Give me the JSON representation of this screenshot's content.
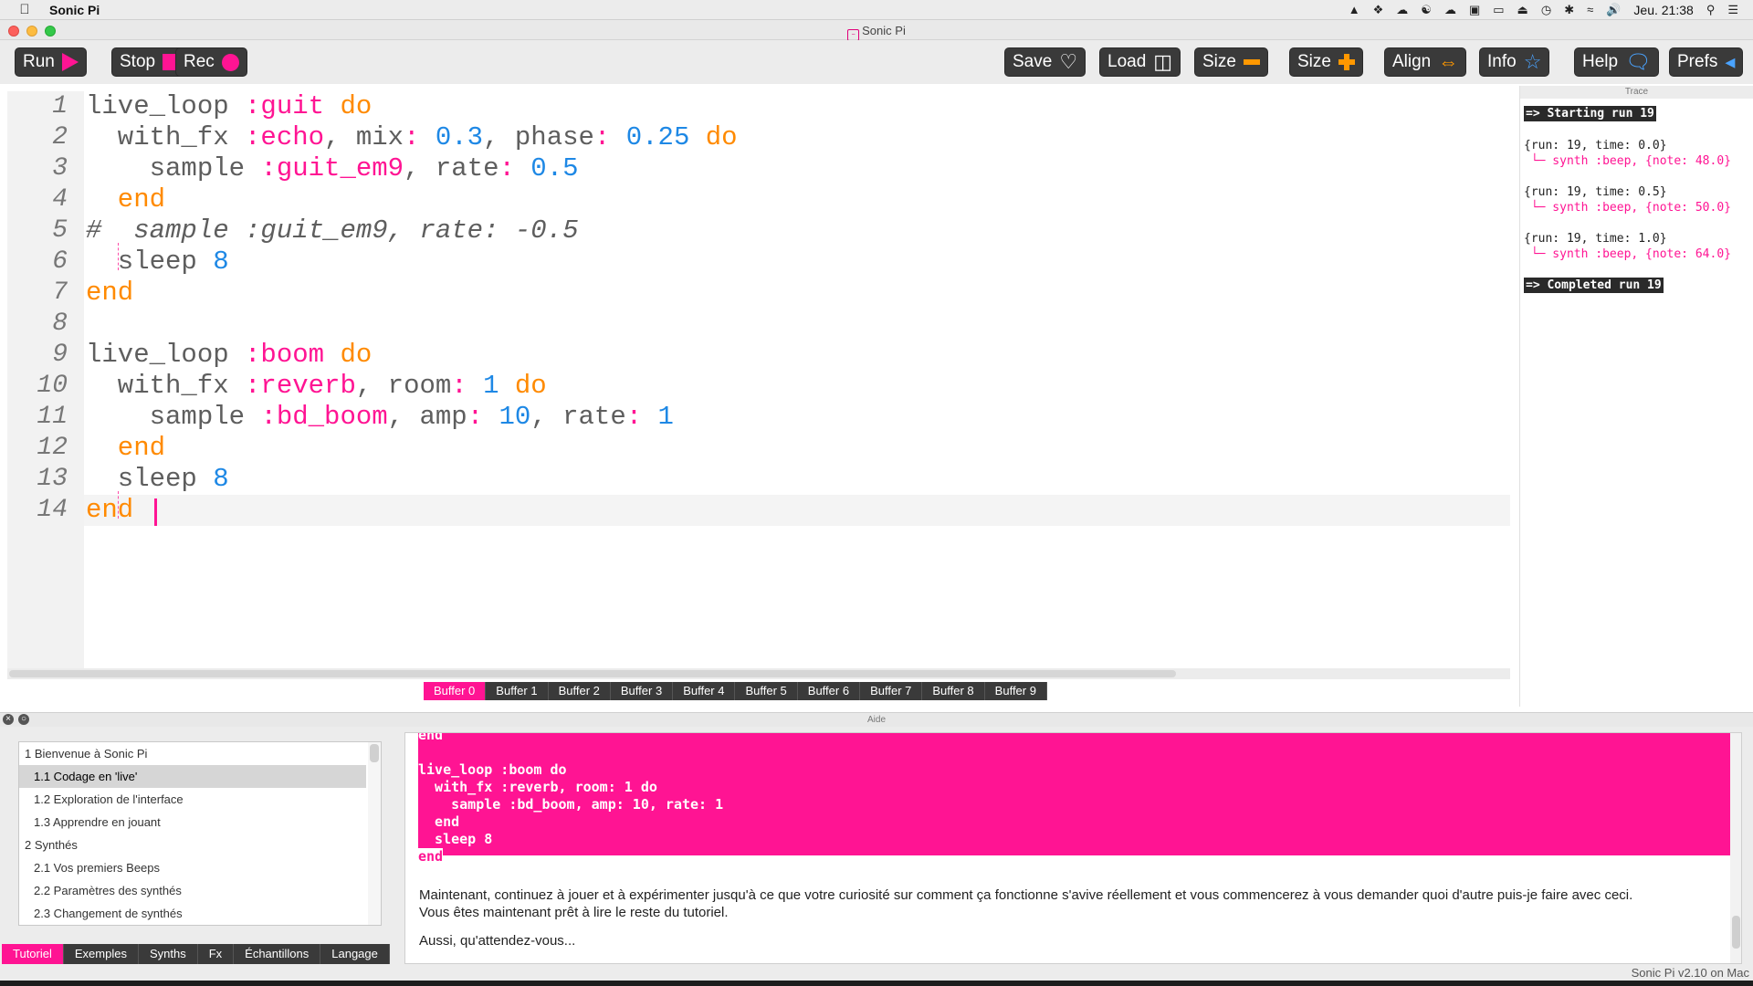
{
  "menubar": {
    "app_name": "Sonic Pi",
    "clock": "Jeu. 21:38"
  },
  "window": {
    "title": "Sonic Pi"
  },
  "toolbar": {
    "run": "Run",
    "stop": "Stop",
    "rec": "Rec",
    "save": "Save",
    "load": "Load",
    "size_down": "Size",
    "size_up": "Size",
    "align": "Align",
    "info": "Info",
    "help": "Help",
    "prefs": "Prefs"
  },
  "editor": {
    "line_numbers": [
      "1",
      "2",
      "3",
      "4",
      "5",
      "6",
      "7",
      "8",
      "9",
      "10",
      "11",
      "12",
      "13",
      "14"
    ],
    "lines": [
      [
        {
          "t": "live_loop ",
          "c": "d"
        },
        {
          "t": ":guit",
          "c": "s"
        },
        {
          "t": " do",
          "c": "k"
        }
      ],
      [
        {
          "t": "  with_fx ",
          "c": "d"
        },
        {
          "t": ":echo",
          "c": "s"
        },
        {
          "t": ", mix",
          "c": "d"
        },
        {
          "t": ":",
          "c": "s"
        },
        {
          "t": " 0.3",
          "c": "n"
        },
        {
          "t": ", phase",
          "c": "d"
        },
        {
          "t": ":",
          "c": "s"
        },
        {
          "t": " 0.25",
          "c": "n"
        },
        {
          "t": " do",
          "c": "k"
        }
      ],
      [
        {
          "t": "    sample ",
          "c": "d"
        },
        {
          "t": ":guit_em9",
          "c": "s"
        },
        {
          "t": ", rate",
          "c": "d"
        },
        {
          "t": ":",
          "c": "s"
        },
        {
          "t": " 0.5",
          "c": "n"
        }
      ],
      [
        {
          "t": "  end",
          "c": "k"
        }
      ],
      [
        {
          "t": "#  sample :guit_em9, rate: -0.5",
          "c": "c"
        }
      ],
      [
        {
          "t": "  sleep ",
          "c": "d"
        },
        {
          "t": "8",
          "c": "n"
        }
      ],
      [
        {
          "t": "end",
          "c": "k"
        }
      ],
      [],
      [
        {
          "t": "live_loop ",
          "c": "d"
        },
        {
          "t": ":boom",
          "c": "s"
        },
        {
          "t": " do",
          "c": "k"
        }
      ],
      [
        {
          "t": "  with_fx ",
          "c": "d"
        },
        {
          "t": ":reverb",
          "c": "s"
        },
        {
          "t": ", room",
          "c": "d"
        },
        {
          "t": ":",
          "c": "s"
        },
        {
          "t": " 1",
          "c": "n"
        },
        {
          "t": " do",
          "c": "k"
        }
      ],
      [
        {
          "t": "    sample ",
          "c": "d"
        },
        {
          "t": ":bd_boom",
          "c": "s"
        },
        {
          "t": ", amp",
          "c": "d"
        },
        {
          "t": ":",
          "c": "s"
        },
        {
          "t": " 10",
          "c": "n"
        },
        {
          "t": ", rate",
          "c": "d"
        },
        {
          "t": ":",
          "c": "s"
        },
        {
          "t": " 1",
          "c": "n"
        }
      ],
      [
        {
          "t": "  end",
          "c": "k"
        }
      ],
      [
        {
          "t": "  sleep ",
          "c": "d"
        },
        {
          "t": "8",
          "c": "n"
        }
      ],
      [
        {
          "t": "end ",
          "c": "k"
        }
      ]
    ]
  },
  "buffers": [
    "Buffer 0",
    "Buffer 1",
    "Buffer 2",
    "Buffer 3",
    "Buffer 4",
    "Buffer 5",
    "Buffer 6",
    "Buffer 7",
    "Buffer 8",
    "Buffer 9"
  ],
  "trace": {
    "title": "Trace",
    "starting": "=> Starting run 19",
    "entries": [
      {
        "head": "{run: 19, time: 0.0}",
        "synth": " └─ synth :beep, {note: 48.0}"
      },
      {
        "head": "{run: 19, time: 0.5}",
        "synth": " └─ synth :beep, {note: 50.0}"
      },
      {
        "head": "{run: 19, time: 1.0}",
        "synth": " └─ synth :beep, {note: 64.0}"
      }
    ],
    "completed": "=> Completed run 19"
  },
  "help": {
    "title": "Aide",
    "toc": [
      {
        "label": "1 Bienvenue à Sonic Pi",
        "sub": false
      },
      {
        "label": "1.1 Codage en 'live'",
        "sub": true
      },
      {
        "label": "1.2 Exploration de l'interface",
        "sub": true
      },
      {
        "label": "1.3 Apprendre en jouant",
        "sub": true
      },
      {
        "label": "2 Synthés",
        "sub": false
      },
      {
        "label": "2.1 Vos premiers Beeps",
        "sub": true
      },
      {
        "label": "2.2 Paramètres des synthés",
        "sub": true
      },
      {
        "label": "2.3 Changement de synthés",
        "sub": true
      }
    ],
    "tabs": [
      "Tutoriel",
      "Exemples",
      "Synths",
      "Fx",
      "Échantillons",
      "Langage"
    ],
    "code_lines": [
      "end",
      "",
      "live_loop :boom do",
      "  with_fx :reverb, room: 1 do",
      "    sample :bd_boom, amp: 10, rate: 1",
      "  end",
      "  sleep 8",
      "end"
    ],
    "para1": "Maintenant, continuez à jouer et à expérimenter jusqu'à ce que votre curiosité sur comment ça fonctionne s'avive réellement et vous commencerez à vous demander quoi d'autre puis-je faire avec ceci.",
    "para2": "Vous êtes maintenant prêt à lire le reste du tutoriel.",
    "para3": "Aussi, qu'attendez-vous..."
  },
  "status": {
    "version": "Sonic Pi v2.10 on Mac"
  }
}
